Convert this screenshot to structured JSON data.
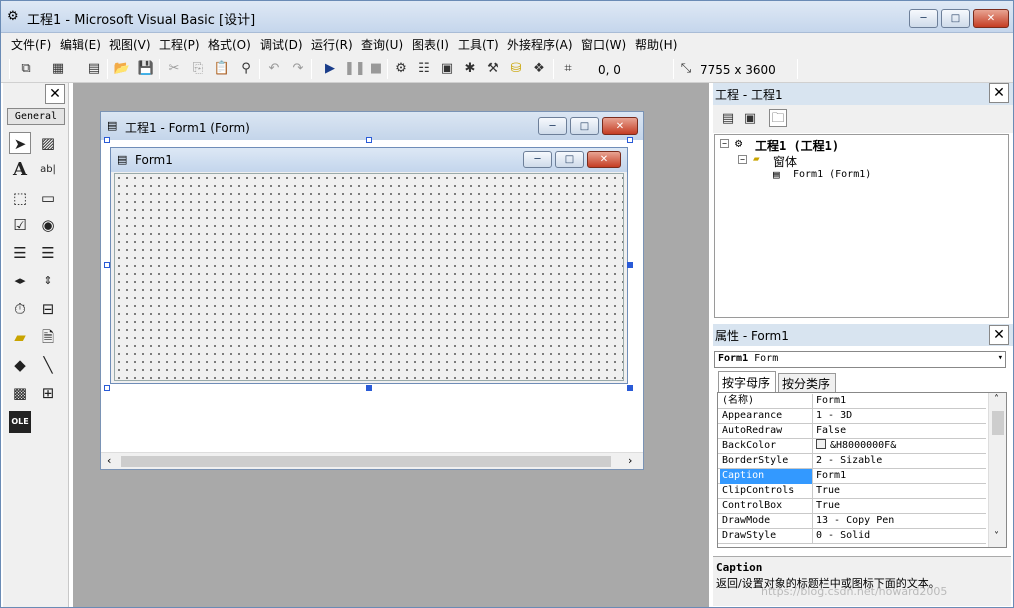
{
  "window": {
    "title": "工程1 - Microsoft Visual Basic [设计]",
    "min": "─",
    "max": "□",
    "close": "✕"
  },
  "menu": [
    "文件(F)",
    "编辑(E)",
    "视图(V)",
    "工程(P)",
    "格式(O)",
    "调试(D)",
    "运行(R)",
    "查询(U)",
    "图表(I)",
    "工具(T)",
    "外接程序(A)",
    "窗口(W)",
    "帮助(H)"
  ],
  "toolbar": {
    "position": "0, 0",
    "size": "7755 x 3600",
    "icons": [
      "add-project-icon",
      "add-form-icon",
      "menu-editor-icon",
      "open-icon",
      "save-icon",
      "cut-icon",
      "copy-icon",
      "paste-icon",
      "find-icon",
      "undo-icon",
      "redo-icon",
      "start-icon",
      "break-icon",
      "end-icon",
      "project-explorer-icon",
      "properties-window-icon",
      "form-layout-icon",
      "object-browser-icon",
      "toolbox-icon",
      "data-view-icon",
      "visual-component-manager-icon"
    ]
  },
  "toolbox": {
    "tab_label": "General",
    "close": "✕",
    "tools": [
      "pointer",
      "picturebox",
      "label",
      "textbox",
      "frame",
      "commandbutton",
      "checkbox",
      "optionbutton",
      "combobox",
      "listbox",
      "hscrollbar",
      "vscrollbar",
      "timer",
      "drivelistbox",
      "dirlistbox",
      "filelistbox",
      "shape",
      "line",
      "image",
      "data",
      "ole"
    ]
  },
  "designer": {
    "mdi_title": "工程1 - Form1 (Form)",
    "form_title": "Form1"
  },
  "project": {
    "title": "工程 - 工程1",
    "close": "✕",
    "tree": {
      "root": "工程1 (工程1)",
      "folder": "窗体",
      "item": "Form1 (Form1)"
    }
  },
  "properties": {
    "title": "属性 - Form1",
    "close": "✕",
    "object_name": "Form1",
    "object_type": "Form",
    "tabs": [
      "按字母序",
      "按分类序"
    ],
    "rows": [
      {
        "name": "(名称)",
        "value": "Form1"
      },
      {
        "name": "Appearance",
        "value": "1 - 3D"
      },
      {
        "name": "AutoRedraw",
        "value": "False"
      },
      {
        "name": "BackColor",
        "value": "&H8000000F&"
      },
      {
        "name": "BorderStyle",
        "value": "2 - Sizable"
      },
      {
        "name": "Caption",
        "value": "Form1"
      },
      {
        "name": "ClipControls",
        "value": "True"
      },
      {
        "name": "ControlBox",
        "value": "True"
      },
      {
        "name": "DrawMode",
        "value": "13 - Copy Pen"
      },
      {
        "name": "DrawStyle",
        "value": "0 - Solid"
      }
    ],
    "selected_row": "Caption",
    "desc_title": "Caption",
    "desc_text": "返回/设置对象的标题栏中或图标下面的文本。"
  },
  "colors": {
    "title_gradient": "#c5d6ec",
    "form_client": "#f0f0f0",
    "design_bg": "#a9a9a9",
    "selected": "#3399ff"
  },
  "watermark": "https://blog.csdn.net/howard2005"
}
